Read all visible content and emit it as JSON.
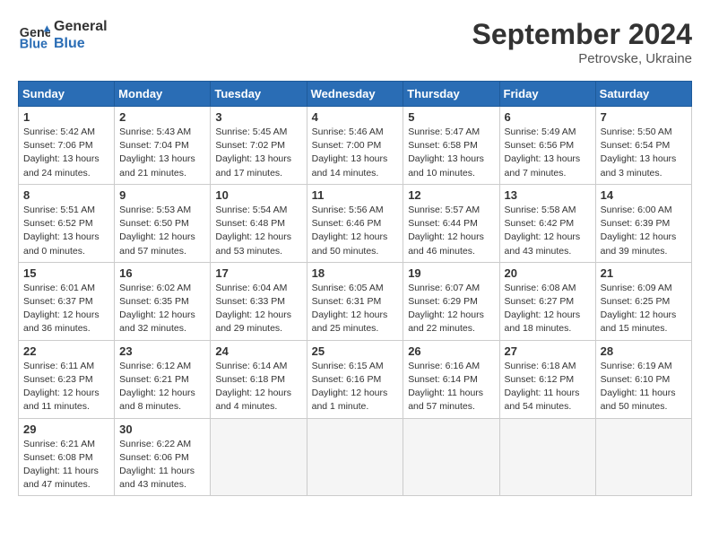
{
  "logo": {
    "line1": "General",
    "line2": "Blue"
  },
  "title": "September 2024",
  "subtitle": "Petrovske, Ukraine",
  "weekdays": [
    "Sunday",
    "Monday",
    "Tuesday",
    "Wednesday",
    "Thursday",
    "Friday",
    "Saturday"
  ],
  "weeks": [
    [
      {
        "day": "1",
        "info": "Sunrise: 5:42 AM\nSunset: 7:06 PM\nDaylight: 13 hours\nand 24 minutes."
      },
      {
        "day": "2",
        "info": "Sunrise: 5:43 AM\nSunset: 7:04 PM\nDaylight: 13 hours\nand 21 minutes."
      },
      {
        "day": "3",
        "info": "Sunrise: 5:45 AM\nSunset: 7:02 PM\nDaylight: 13 hours\nand 17 minutes."
      },
      {
        "day": "4",
        "info": "Sunrise: 5:46 AM\nSunset: 7:00 PM\nDaylight: 13 hours\nand 14 minutes."
      },
      {
        "day": "5",
        "info": "Sunrise: 5:47 AM\nSunset: 6:58 PM\nDaylight: 13 hours\nand 10 minutes."
      },
      {
        "day": "6",
        "info": "Sunrise: 5:49 AM\nSunset: 6:56 PM\nDaylight: 13 hours\nand 7 minutes."
      },
      {
        "day": "7",
        "info": "Sunrise: 5:50 AM\nSunset: 6:54 PM\nDaylight: 13 hours\nand 3 minutes."
      }
    ],
    [
      {
        "day": "8",
        "info": "Sunrise: 5:51 AM\nSunset: 6:52 PM\nDaylight: 13 hours\nand 0 minutes."
      },
      {
        "day": "9",
        "info": "Sunrise: 5:53 AM\nSunset: 6:50 PM\nDaylight: 12 hours\nand 57 minutes."
      },
      {
        "day": "10",
        "info": "Sunrise: 5:54 AM\nSunset: 6:48 PM\nDaylight: 12 hours\nand 53 minutes."
      },
      {
        "day": "11",
        "info": "Sunrise: 5:56 AM\nSunset: 6:46 PM\nDaylight: 12 hours\nand 50 minutes."
      },
      {
        "day": "12",
        "info": "Sunrise: 5:57 AM\nSunset: 6:44 PM\nDaylight: 12 hours\nand 46 minutes."
      },
      {
        "day": "13",
        "info": "Sunrise: 5:58 AM\nSunset: 6:42 PM\nDaylight: 12 hours\nand 43 minutes."
      },
      {
        "day": "14",
        "info": "Sunrise: 6:00 AM\nSunset: 6:39 PM\nDaylight: 12 hours\nand 39 minutes."
      }
    ],
    [
      {
        "day": "15",
        "info": "Sunrise: 6:01 AM\nSunset: 6:37 PM\nDaylight: 12 hours\nand 36 minutes."
      },
      {
        "day": "16",
        "info": "Sunrise: 6:02 AM\nSunset: 6:35 PM\nDaylight: 12 hours\nand 32 minutes."
      },
      {
        "day": "17",
        "info": "Sunrise: 6:04 AM\nSunset: 6:33 PM\nDaylight: 12 hours\nand 29 minutes."
      },
      {
        "day": "18",
        "info": "Sunrise: 6:05 AM\nSunset: 6:31 PM\nDaylight: 12 hours\nand 25 minutes."
      },
      {
        "day": "19",
        "info": "Sunrise: 6:07 AM\nSunset: 6:29 PM\nDaylight: 12 hours\nand 22 minutes."
      },
      {
        "day": "20",
        "info": "Sunrise: 6:08 AM\nSunset: 6:27 PM\nDaylight: 12 hours\nand 18 minutes."
      },
      {
        "day": "21",
        "info": "Sunrise: 6:09 AM\nSunset: 6:25 PM\nDaylight: 12 hours\nand 15 minutes."
      }
    ],
    [
      {
        "day": "22",
        "info": "Sunrise: 6:11 AM\nSunset: 6:23 PM\nDaylight: 12 hours\nand 11 minutes."
      },
      {
        "day": "23",
        "info": "Sunrise: 6:12 AM\nSunset: 6:21 PM\nDaylight: 12 hours\nand 8 minutes."
      },
      {
        "day": "24",
        "info": "Sunrise: 6:14 AM\nSunset: 6:18 PM\nDaylight: 12 hours\nand 4 minutes."
      },
      {
        "day": "25",
        "info": "Sunrise: 6:15 AM\nSunset: 6:16 PM\nDaylight: 12 hours\nand 1 minute."
      },
      {
        "day": "26",
        "info": "Sunrise: 6:16 AM\nSunset: 6:14 PM\nDaylight: 11 hours\nand 57 minutes."
      },
      {
        "day": "27",
        "info": "Sunrise: 6:18 AM\nSunset: 6:12 PM\nDaylight: 11 hours\nand 54 minutes."
      },
      {
        "day": "28",
        "info": "Sunrise: 6:19 AM\nSunset: 6:10 PM\nDaylight: 11 hours\nand 50 minutes."
      }
    ],
    [
      {
        "day": "29",
        "info": "Sunrise: 6:21 AM\nSunset: 6:08 PM\nDaylight: 11 hours\nand 47 minutes."
      },
      {
        "day": "30",
        "info": "Sunrise: 6:22 AM\nSunset: 6:06 PM\nDaylight: 11 hours\nand 43 minutes."
      },
      null,
      null,
      null,
      null,
      null
    ]
  ]
}
